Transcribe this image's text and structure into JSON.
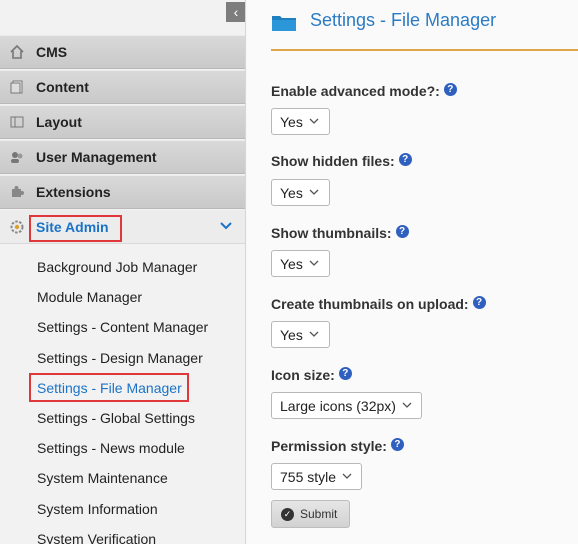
{
  "sidebar": {
    "collapse_icon": "chevron-left-icon",
    "nav": [
      {
        "label": "CMS",
        "icon": "home-icon"
      },
      {
        "label": "Content",
        "icon": "document-icon"
      },
      {
        "label": "Layout",
        "icon": "layout-icon"
      },
      {
        "label": "User Management",
        "icon": "users-icon"
      },
      {
        "label": "Extensions",
        "icon": "puzzle-icon"
      },
      {
        "label": "Site Admin",
        "icon": "gear-icon",
        "active": true
      }
    ],
    "submenu": [
      {
        "label": "Background Job Manager"
      },
      {
        "label": "Module Manager"
      },
      {
        "label": "Settings - Content Manager"
      },
      {
        "label": "Settings - Design Manager"
      },
      {
        "label": "Settings - File Manager",
        "active": true
      },
      {
        "label": "Settings - Global Settings"
      },
      {
        "label": "Settings - News module"
      },
      {
        "label": "System Maintenance"
      },
      {
        "label": "System Information"
      },
      {
        "label": "System Verification"
      }
    ]
  },
  "page": {
    "title": "Settings - File Manager",
    "fields": [
      {
        "label": "Enable advanced mode?:",
        "value": "Yes"
      },
      {
        "label": "Show hidden files:",
        "value": "Yes"
      },
      {
        "label": "Show thumbnails:",
        "value": "Yes"
      },
      {
        "label": "Create thumbnails on upload:",
        "value": "Yes"
      },
      {
        "label": "Icon size:",
        "value": "Large icons (32px)"
      },
      {
        "label": "Permission style:",
        "value": "755 style"
      }
    ],
    "submit_label": "Submit",
    "help_glyph": "?"
  },
  "colors": {
    "accent_blue": "#1a73c7",
    "highlight_red": "#e0383a",
    "title_rule": "#e1a54a"
  }
}
